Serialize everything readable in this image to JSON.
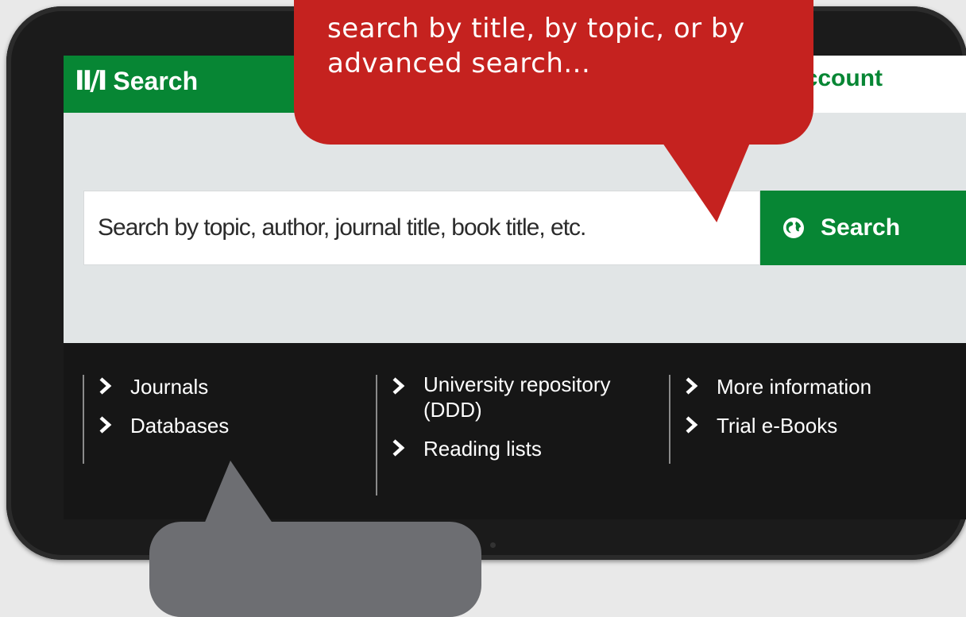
{
  "header": {
    "logo_mark": "II/I",
    "logo_text": "Search",
    "account_text": "account"
  },
  "search": {
    "placeholder": "Search by topic, author, journal title, book title, etc.",
    "button_label": "Search"
  },
  "links": {
    "column1": [
      "Journals",
      "Databases"
    ],
    "column2": [
      "University repository (DDD)",
      "Reading lists"
    ],
    "column3": [
      "More information",
      "Trial e-Books"
    ]
  },
  "callouts": {
    "top_text": "search by title, by topic, or by advanced search...",
    "bottom_text": ""
  },
  "colors": {
    "brand_green": "#078634",
    "callout_red": "#c5221f",
    "callout_gray": "#6d6e72",
    "footer_dark": "#161616",
    "screen_bg": "#e1e5e6"
  },
  "icons": [
    "globe-icon",
    "chevron-right-icon"
  ]
}
